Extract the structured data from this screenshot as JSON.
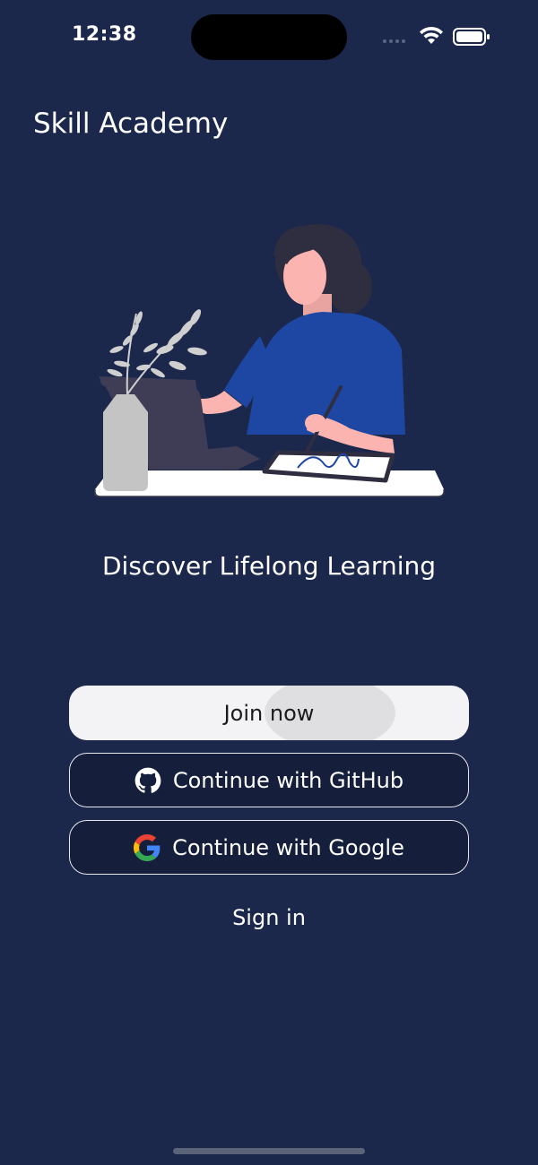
{
  "status_bar": {
    "time": "12:38",
    "icons": [
      "cellular-signal-icon",
      "wifi-icon",
      "battery-icon"
    ]
  },
  "app": {
    "title": "Skill Academy",
    "tagline": "Discover Lifelong Learning"
  },
  "hero_illustration": "person-at-desk-with-laptop-and-tablet",
  "buttons": {
    "join": "Join now",
    "github": "Continue with GitHub",
    "google": "Continue with Google",
    "signin": "Sign in"
  },
  "icons": {
    "github": "github-icon",
    "google": "google-icon"
  },
  "colors": {
    "background": "#1b284b",
    "primary_button": "#f3f3f5",
    "outline_button": "#151f3c",
    "text": "#ffffff"
  }
}
